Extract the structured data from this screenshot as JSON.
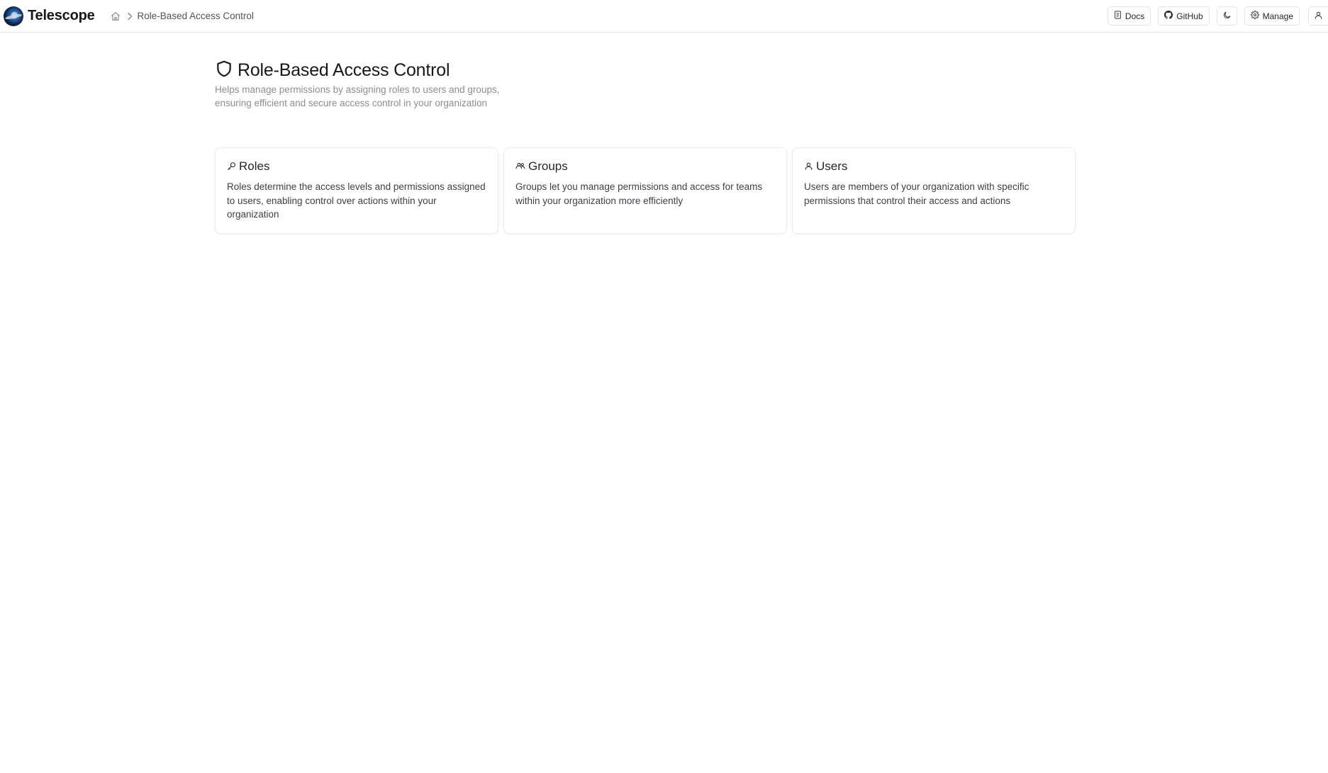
{
  "header": {
    "app_name": "Telescope",
    "breadcrumb": {
      "home_icon": "home-icon",
      "current": "Role-Based Access Control"
    },
    "buttons": {
      "docs_label": "Docs",
      "github_label": "GitHub",
      "manage_label": "Manage",
      "theme_icon": "moon-icon",
      "user_icon": "user-icon"
    }
  },
  "page": {
    "icon": "shield-icon",
    "title": "Role-Based Access Control",
    "subtitle": "Helps manage permissions by assigning roles to users and groups, ensuring efficient and secure access control in your organization"
  },
  "cards": [
    {
      "icon": "key-icon",
      "title": "Roles",
      "description": "Roles determine the access levels and permissions assigned to users, enabling control over actions within your organization"
    },
    {
      "icon": "users-icon",
      "title": "Groups",
      "description": "Groups let you manage permissions and access for teams within your organization more efficiently"
    },
    {
      "icon": "user-icon",
      "title": "Users",
      "description": "Users are members of your organization with specific permissions that control their access and actions"
    }
  ],
  "colors": {
    "border": "#e4e4e7",
    "text_primary": "#18181b",
    "text_muted": "#8c8c96"
  }
}
